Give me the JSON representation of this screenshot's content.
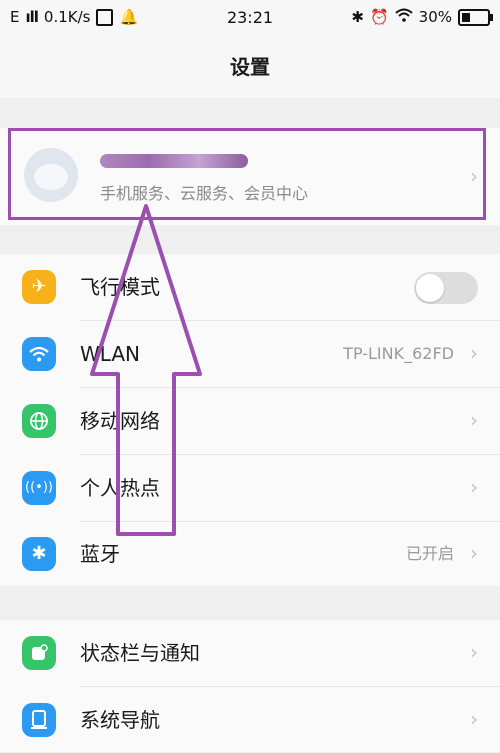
{
  "status_bar": {
    "carrier": "E",
    "signal": "ıll",
    "speed": "0.1K/s",
    "time": "23:21",
    "battery": "30%"
  },
  "title": "设置",
  "account": {
    "subtitle": "手机服务、云服务、会员中心"
  },
  "settings_group_1": [
    {
      "label": "飞行模式",
      "icon": "airplane-icon",
      "color": "#f7b21a",
      "toggle": false
    },
    {
      "label": "WLAN",
      "icon": "wifi-icon",
      "color": "#2b9af3",
      "value": "TP-LINK_62FD"
    },
    {
      "label": "移动网络",
      "icon": "globe-icon",
      "color": "#35c46a"
    },
    {
      "label": "个人热点",
      "icon": "hotspot-icon",
      "color": "#2b9af3"
    },
    {
      "label": "蓝牙",
      "icon": "bluetooth-icon",
      "color": "#2b9af3",
      "value": "已开启"
    }
  ],
  "settings_group_2": [
    {
      "label": "状态栏与通知",
      "icon": "notification-icon",
      "color": "#35c46a"
    },
    {
      "label": "系统导航",
      "icon": "navigation-icon",
      "color": "#2b9af3"
    }
  ],
  "annotation_color": "#9c4fae"
}
